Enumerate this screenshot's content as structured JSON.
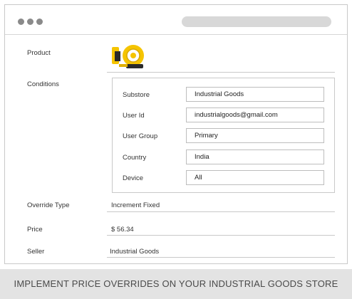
{
  "window": {
    "dots": [
      "window-dot",
      "window-dot",
      "window-dot"
    ]
  },
  "form": {
    "product_label": "Product",
    "product_icon": "tape-measure-icon",
    "conditions_label": "Conditions",
    "conditions": [
      {
        "label": "Substore",
        "value": "Industrial Goods"
      },
      {
        "label": "User Id",
        "value": "industrialgoods@gmail.com"
      },
      {
        "label": "User Group",
        "value": "Primary"
      },
      {
        "label": "Country",
        "value": "India"
      },
      {
        "label": "Device",
        "value": "All"
      }
    ],
    "override_type_label": "Override Type",
    "override_type_value": "Increment Fixed",
    "price_label": "Price",
    "price_value": "$ 56.34",
    "seller_label": "Seller",
    "seller_value": "Industrial Goods"
  },
  "footer": {
    "text": "IMPLEMENT PRICE OVERRIDES ON YOUR INDUSTRIAL GOODS STORE"
  },
  "colors": {
    "icon_yellow": "#f5c400",
    "icon_dark": "#2a2a2a",
    "footer_bg": "#e3e3e3"
  }
}
